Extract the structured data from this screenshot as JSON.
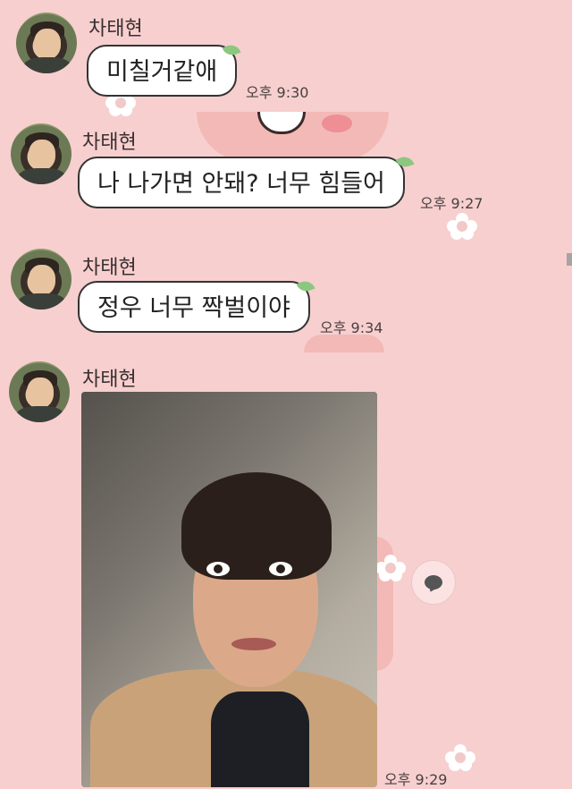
{
  "messages": [
    {
      "sender": "차태현",
      "text": "미칠거같애",
      "time": "오후 9:30"
    },
    {
      "sender": "차태현",
      "text": "나 나가면 안돼? 너무 힘들어",
      "time": "오후 9:27"
    },
    {
      "sender": "차태현",
      "text": "정우 너무 짝벌이야",
      "time": "오후 9:34"
    },
    {
      "sender": "차태현",
      "photo": "selfie-photo",
      "time": "오후 9:29"
    }
  ],
  "icons": {
    "share": "speech-bubble-icon",
    "leaf": "leaf-icon"
  },
  "colors": {
    "background": "#f7cfcf",
    "bubble": "#ffffff",
    "leaf": "#8cc77f"
  }
}
